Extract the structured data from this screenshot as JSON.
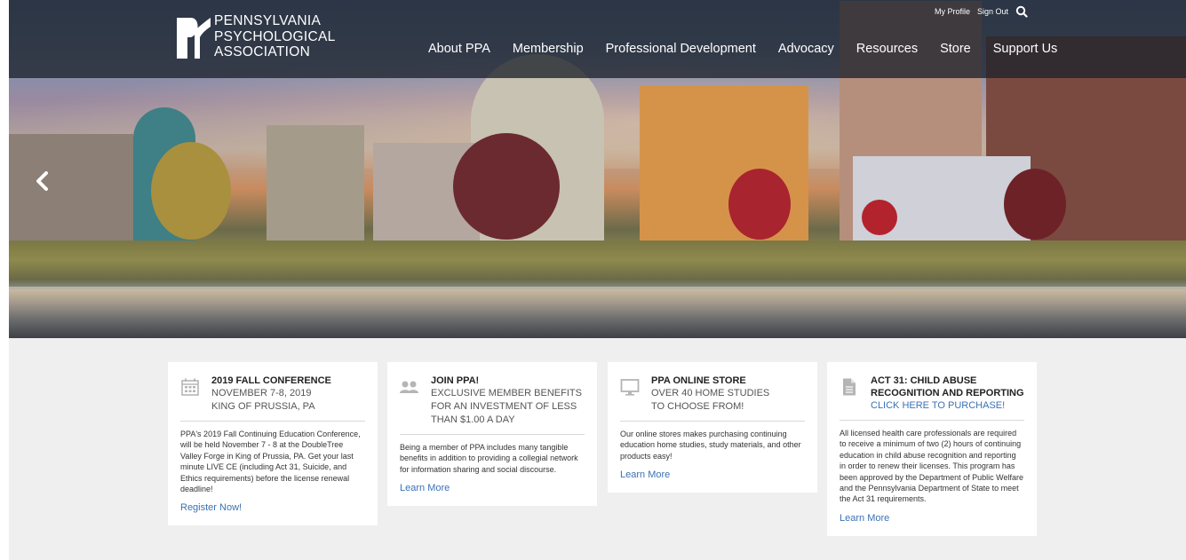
{
  "brand": {
    "logo_line1": "PENNSYLVANIA",
    "logo_line2": "PSYCHOLOGICAL",
    "logo_line3": "ASSOCIATION"
  },
  "utility_nav": {
    "my_profile": "My Profile",
    "sign_out": "Sign Out",
    "search_icon": "search-icon"
  },
  "main_nav": {
    "items": [
      {
        "label": "About PPA"
      },
      {
        "label": "Membership"
      },
      {
        "label": "Professional Development"
      },
      {
        "label": "Advocacy"
      },
      {
        "label": "Resources"
      },
      {
        "label": "Store"
      },
      {
        "label": "Support Us"
      }
    ]
  },
  "hero": {
    "prev_icon": "chevron-left-icon"
  },
  "cards": [
    {
      "icon": "calendar-icon",
      "title": "2019 FALL CONFERENCE",
      "sub1": "NOVEMBER 7-8, 2019",
      "sub2": "KING OF PRUSSIA, PA",
      "body": "PPA's 2019 Fall Continuing Education Conference, will be held November 7 - 8 at the DoubleTree Valley Forge in King of Prussia, PA. Get your last minute LIVE CE (including Act 31, Suicide, and Ethics requirements) before the license renewal deadline!",
      "link": "Register Now!"
    },
    {
      "icon": "users-icon",
      "title": "JOIN PPA!",
      "sub1": "EXCLUSIVE MEMBER BENEFITS FOR AN INVESTMENT OF LESS THAN $1.00 A DAY",
      "body": "Being a member of PPA includes many tangible benefits in addition to providing a collegial network for information sharing and social discourse.",
      "link": "Learn More"
    },
    {
      "icon": "monitor-icon",
      "title": "PPA ONLINE STORE",
      "sub1": "OVER 40 HOME STUDIES",
      "sub2": "TO CHOOSE FROM!",
      "body": "Our online stores makes purchasing continuing education home studies, study materials, and other products easy!",
      "link": "Learn More"
    },
    {
      "icon": "document-icon",
      "title": "ACT 31: CHILD ABUSE RECOGNITION AND REPORTING",
      "sub1": "CLICK HERE TO PURCHASE!",
      "body": "All licensed health care professionals are required to receive a minimum of two (2) hours of continuing education in child abuse recognition and reporting in order to renew their licenses. This program has been approved by the Department of Public Welfare and the Pennsylvania Department of State to meet the Act 31 requirements.",
      "link": "Learn More"
    }
  ]
}
